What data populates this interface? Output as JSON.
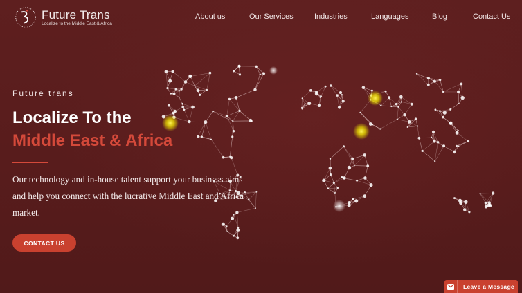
{
  "brand": {
    "name": "Future Trans",
    "tagline": "Localize to the Middle East & Africa"
  },
  "nav": {
    "items": [
      {
        "label": "About us"
      },
      {
        "label": "Our Services"
      },
      {
        "label": "Industries"
      },
      {
        "label": "Languages"
      },
      {
        "label": "Blog"
      },
      {
        "label": "Contact Us"
      }
    ]
  },
  "hero": {
    "eyebrow": "Future trans",
    "heading_line1": "Localize To the",
    "heading_line2": "Middle East & Africa",
    "description": "Our technology and in-house talent support your business aims and help you connect with the lucrative Middle East and Africa market.",
    "cta_label": "CONTACT US"
  },
  "widget": {
    "label": "Leave a Message",
    "icon": "envelope-icon"
  },
  "colors": {
    "background": "#5b1e1e",
    "accent": "#d4493a",
    "button": "#c9412f",
    "highlight": "#f2e600"
  }
}
